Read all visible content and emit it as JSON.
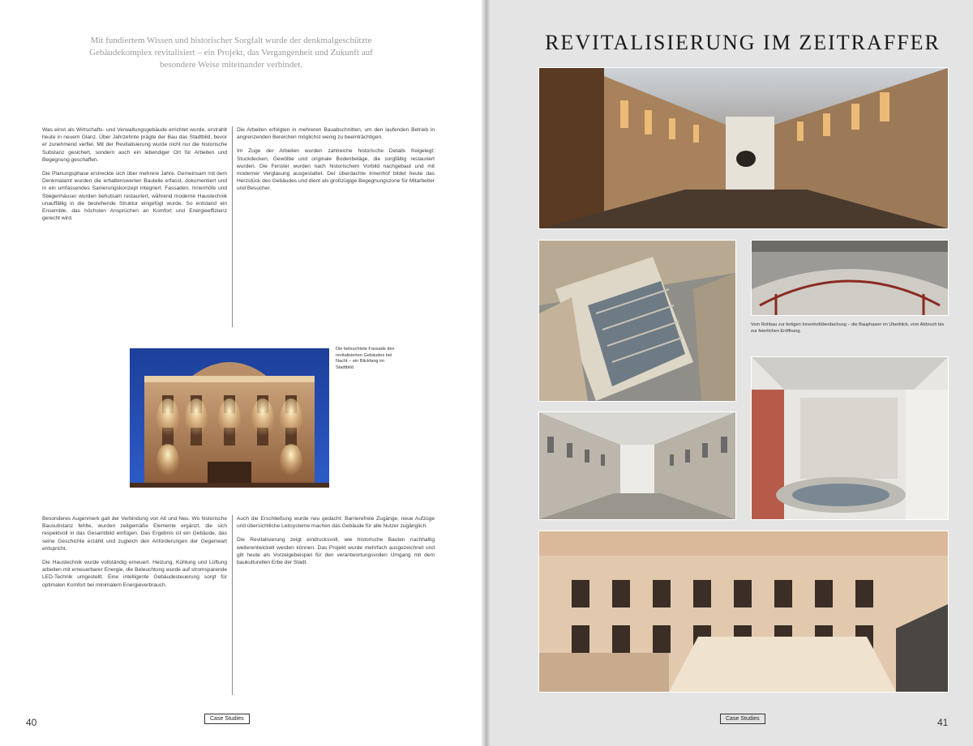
{
  "left_page": {
    "lead_text": "Mit fundiertem Wissen und historischer Sorgfalt wurde der denkmalgeschützte Gebäudekomplex revitalisiert – ein Projekt, das Vergangenheit und Zukunft auf besondere Weise miteinander verbindet.",
    "column1_top": [
      "Was einst als Wirtschafts- und Verwaltungsgebäude errichtet wurde, erstrahlt heute in neuem Glanz. Über Jahrzehnte prägte der Bau das Stadtbild, bevor er zunehmend verfiel. Mit der Revitalisierung wurde nicht nur die historische Substanz gesichert, sondern auch ein lebendiger Ort für Arbeiten und Begegnung geschaffen.",
      "Die Planungsphase erstreckte sich über mehrere Jahre. Gemeinsam mit dem Denkmalamt wurden die erhaltenswerten Bauteile erfasst, dokumentiert und in ein umfassendes Sanierungskonzept integriert. Fassaden, Innenhöfe und Stiegenhäuser wurden behutsam restauriert, während moderne Haustechnik unauffällig in die bestehende Struktur eingefügt wurde. So entstand ein Ensemble, das höchsten Ansprüchen an Komfort und Energieeffizienz gerecht wird."
    ],
    "column2_top": [
      "Die Arbeiten erfolgten in mehreren Bauabschnitten, um den laufenden Betrieb in angrenzenden Bereichen möglichst wenig zu beeinträchtigen.",
      "Im Zuge der Arbeiten wurden zahlreiche historische Details freigelegt: Stuckdecken, Gewölbe und originale Bodenbeläge, die sorgfältig restauriert wurden. Die Fenster wurden nach historischem Vorbild nachgebaut und mit moderner Verglasung ausgestattet. Der überdachte Innenhof bildet heute das Herzstück des Gebäudes und dient als großzügige Begegnungszone für Mitarbeiter und Besucher."
    ],
    "photo_caption": "Die beleuchtete Fassade des revitalisierten Gebäudes bei Nacht – ein Blickfang im Stadtbild.",
    "column1_bottom": [
      "Besonderes Augenmerk galt der Verbindung von Alt und Neu. Wo historische Bausubstanz fehlte, wurden zeitgemäße Elemente ergänzt, die sich respektvoll in das Gesamtbild einfügen. Das Ergebnis ist ein Gebäude, das seine Geschichte erzählt und zugleich den Anforderungen der Gegenwart entspricht.",
      "Die Haustechnik wurde vollständig erneuert. Heizung, Kühlung und Lüftung arbeiten mit erneuerbarer Energie, die Beleuchtung wurde auf stromsparende LED-Technik umgestellt. Eine intelligente Gebäudesteuerung sorgt für optimalen Komfort bei minimalem Energieverbrauch."
    ],
    "column2_bottom": [
      "Auch die Erschließung wurde neu gedacht: Barrierefreie Zugänge, neue Aufzüge und übersichtliche Leitsysteme machen das Gebäude für alle Nutzer zugänglich.",
      "Die Revitalisierung zeigt eindrucksvoll, wie historische Bauten nachhaltig weiterentwickelt werden können. Das Projekt wurde mehrfach ausgezeichnet und gilt heute als Vorzeigebeispiel für den verantwortungsvollen Umgang mit dem baukulturellen Erbe der Stadt."
    ],
    "page_number": "40",
    "footer_label": "Case Studies"
  },
  "right_page": {
    "title": "REVITALISIERUNG IM ZEITRAFFER",
    "caption": "Vom Rohbau zur fertigen Innenhofüberdachung – die Bauphasen im Überblick, vom Abbruch bis zur feierlichen Eröffnung.",
    "page_number": "41",
    "footer_label": "Case Studies"
  },
  "colors": {
    "gutter_shadow": "#b4b4b4",
    "right_page_background": "#e4e4e4",
    "warm_light": "#f3c27a",
    "stone": "#d8cfc2"
  }
}
